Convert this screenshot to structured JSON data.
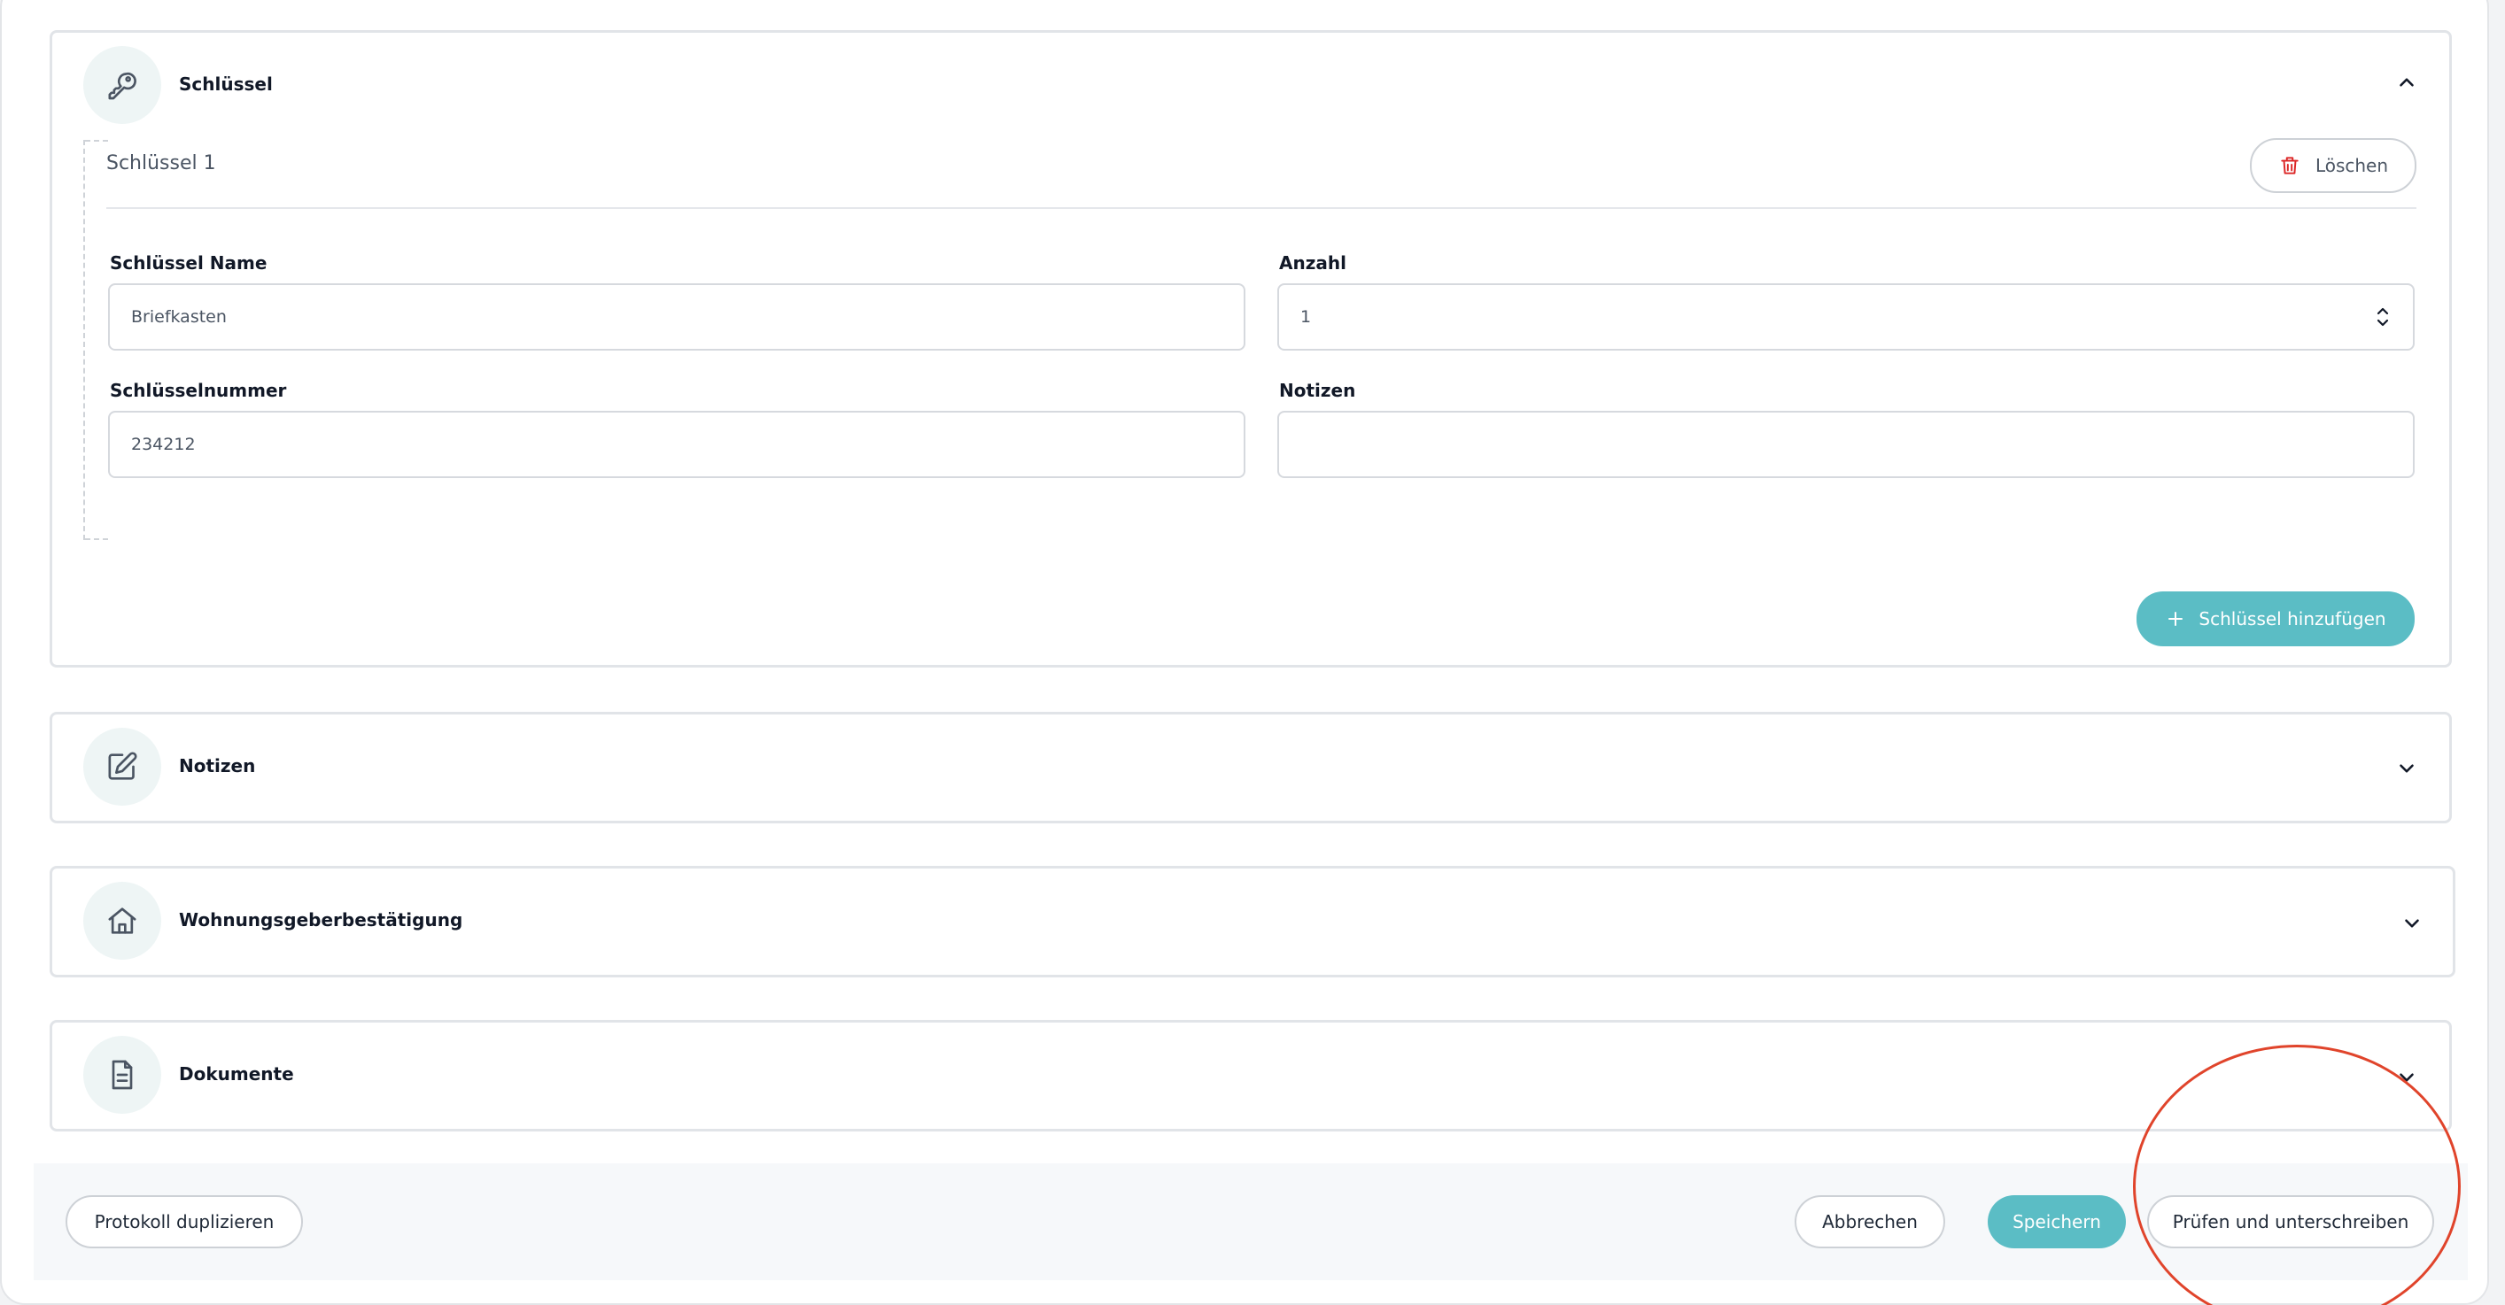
{
  "sections": {
    "keys": {
      "title": "Schlüssel",
      "icon": "key-icon",
      "expanded": true
    },
    "notes": {
      "title": "Notizen",
      "icon": "edit-icon"
    },
    "landlord": {
      "title": "Wohnungsgeberbestätigung",
      "icon": "home-icon"
    },
    "documents": {
      "title": "Dokumente",
      "icon": "document-icon"
    }
  },
  "key_entry": {
    "heading": "Schlüssel 1",
    "delete_label": "Löschen",
    "fields": {
      "name_label": "Schlüssel Name",
      "name_value": "Briefkasten",
      "count_label": "Anzahl",
      "count_value": "1",
      "number_label": "Schlüsselnummer",
      "number_value": "234212",
      "notes_label": "Notizen",
      "notes_value": ""
    }
  },
  "add_key_label": "Schlüssel hinzufügen",
  "footer": {
    "duplicate_label": "Protokoll duplizieren",
    "cancel_label": "Abbrechen",
    "save_label": "Speichern",
    "sign_label": "Prüfen und unterschreiben"
  },
  "colors": {
    "accent": "#5bbdc5",
    "danger": "#dc2626",
    "annotation": "#e0442b"
  }
}
